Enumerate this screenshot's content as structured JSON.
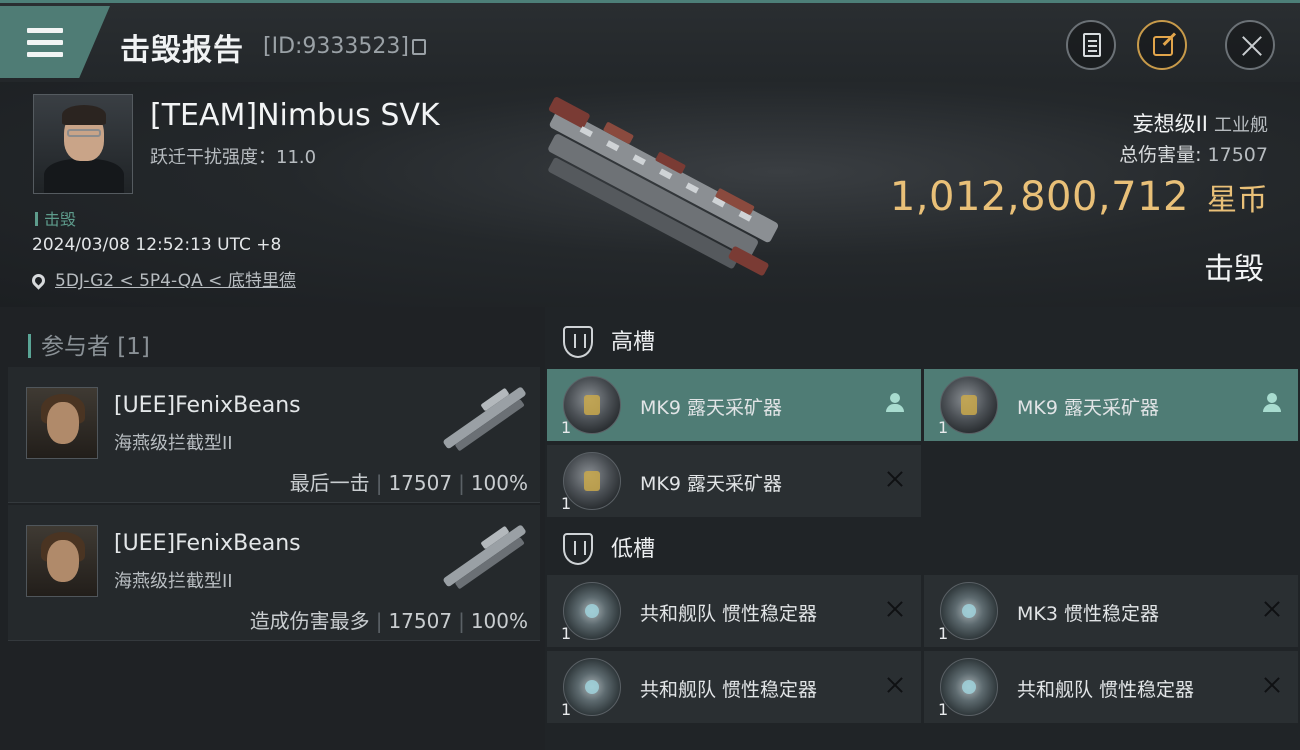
{
  "header": {
    "title": "击毁报告",
    "id_text": "[ID:9333523]"
  },
  "victim": {
    "name": "[TEAM]Nimbus SVK",
    "warp_scramble": "跃迁干扰强度：11.0",
    "status_tag": "击毁",
    "timestamp": "2024/03/08 12:52:13 UTC +8",
    "location": "5DJ-G2 < 5P4-QA < 底特里德",
    "ship_class": "妄想级II",
    "ship_type": "工业舰",
    "total_damage_label": "总伤害量:",
    "total_damage_value": "17507",
    "isk_value": "1,012,800,712",
    "isk_unit": "星币",
    "result": "击毁"
  },
  "participants": {
    "title": "参与者 [1]",
    "rows": [
      {
        "name": "[UEE]FenixBeans",
        "ship": "海燕级拦截型II",
        "role": "最后一击",
        "damage": "17507",
        "percent": "100%"
      },
      {
        "name": "[UEE]FenixBeans",
        "ship": "海燕级拦截型II",
        "role": "造成伤害最多",
        "damage": "17507",
        "percent": "100%"
      }
    ]
  },
  "fitting": {
    "high_slots_title": "高槽",
    "low_slots_title": "低槽",
    "high_slots": [
      {
        "name": "MK9 露天采矿器",
        "qty": "1",
        "state": "dropped"
      },
      {
        "name": "MK9 露天采矿器",
        "qty": "1",
        "state": "dropped"
      },
      {
        "name": "MK9 露天采矿器",
        "qty": "1",
        "state": "destroyed"
      }
    ],
    "low_slots": [
      {
        "name": "共和舰队 惯性稳定器",
        "qty": "1",
        "state": "destroyed"
      },
      {
        "name": "MK3 惯性稳定器",
        "qty": "1",
        "state": "destroyed"
      },
      {
        "name": "共和舰队 惯性稳定器",
        "qty": "1",
        "state": "destroyed"
      },
      {
        "name": "共和舰队 惯性稳定器",
        "qty": "1",
        "state": "destroyed"
      }
    ]
  },
  "icons": {
    "menu": "hamburger-menu-icon",
    "clipboard": "clipboard-icon",
    "share": "share-icon",
    "close": "close-icon",
    "pin": "location-pin-icon",
    "slot_shield": "slot-shield-icon",
    "dropped": "person-icon",
    "destroyed": "x-icon"
  },
  "colors": {
    "accent": "#4f7c75",
    "isk": "#e9c078",
    "status": "#5e9c8c"
  }
}
